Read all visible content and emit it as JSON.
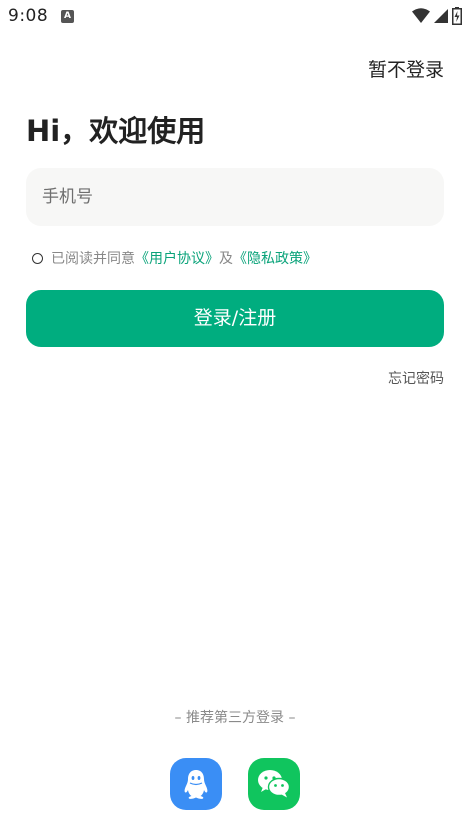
{
  "status_bar": {
    "time": "9:08",
    "notification_icon": "a-icon",
    "icons": [
      "wifi-icon",
      "signal-icon",
      "battery-icon"
    ]
  },
  "header": {
    "skip_login": "暂不登录"
  },
  "greeting": "Hi，欢迎使用",
  "phone_field": {
    "placeholder": "手机号",
    "value": ""
  },
  "agreement": {
    "prefix": "已阅读并同意",
    "user_agreement": "《用户协议》",
    "conjunction": "及",
    "privacy_policy": "《隐私政策》"
  },
  "login_button": "登录/注册",
  "forgot_password": "忘记密码",
  "third_party": {
    "label": "– 推荐第三方登录 –",
    "providers": [
      "qq-icon",
      "wechat-icon"
    ]
  },
  "colors": {
    "accent": "#00ad7f",
    "link": "#0aa37a",
    "qq": "#3a8ef5",
    "wechat": "#10c55e",
    "input_bg": "#f7f7f6"
  }
}
